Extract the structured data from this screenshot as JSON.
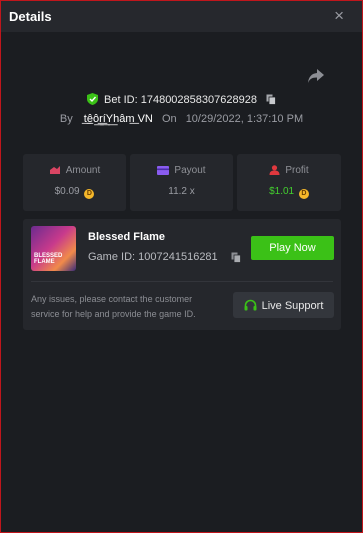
{
  "header": {
    "title": "Details",
    "close_glyph": "×"
  },
  "bet": {
    "label": "Bet ID:",
    "id": "1748002858307628928",
    "by_label": "By",
    "user": "t͟ê̲ô͟r͟í͟Y͟hâm͟ VN",
    "on_label": "On",
    "datetime": "10/29/2022, 1:37:10 PM"
  },
  "stats": {
    "amount": {
      "label": "Amount",
      "value": "$0.09",
      "icon": "amount-icon"
    },
    "payout": {
      "label": "Payout",
      "value": "11.2 x",
      "icon": "card-icon"
    },
    "profit": {
      "label": "Profit",
      "value": "$1.01",
      "icon": "profit-icon"
    }
  },
  "game": {
    "name": "Blessed Flame",
    "id_label": "Game ID:",
    "id": "1007241516281",
    "thumb_text": "BLESSED FLAME",
    "play_label": "Play Now"
  },
  "support": {
    "message": "Any issues, please contact the customer service for help and provide the game ID.",
    "button_label": "Live Support"
  },
  "coin_glyph": "D",
  "colors": {
    "accent_green": "#3bc117",
    "profit_green": "#43cf2f",
    "coin_gold": "#f5b72a",
    "frame_red": "#c0161c"
  }
}
